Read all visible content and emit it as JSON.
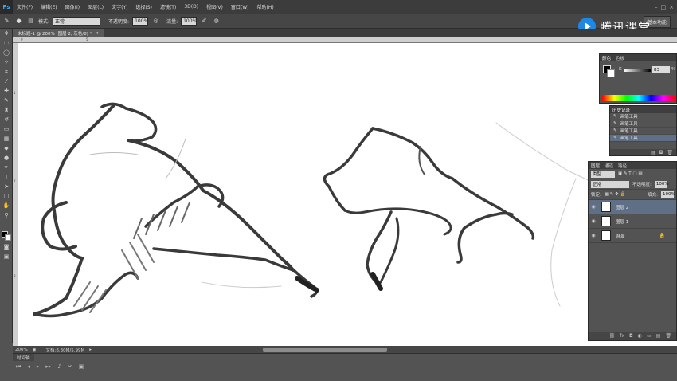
{
  "app": {
    "logo": "Ps"
  },
  "menu": [
    "文件(F)",
    "编辑(E)",
    "图像(I)",
    "图层(L)",
    "文字(Y)",
    "选择(S)",
    "滤镜(T)",
    "3D(D)",
    "视图(V)",
    "窗口(W)",
    "帮助(H)"
  ],
  "options": {
    "mode_label": "模式:",
    "mode_value": "正常",
    "opacity_label": "不透明度:",
    "opacity_value": "100%",
    "flow_label": "流量:",
    "flow_value": "100%",
    "workspace": "基本功能"
  },
  "document": {
    "tab_title": "未标题-1 @ 200% (图层 2, 灰色/8) *"
  },
  "status": {
    "zoom": "200%",
    "doc_info": "文档:8.30M/5.99M"
  },
  "timeline": {
    "tab": "时间轴"
  },
  "color_panel": {
    "tabs": [
      "颜色",
      "色板"
    ],
    "channel_label": "K",
    "channel_value": "83",
    "unit": "%",
    "k_level": 0.83
  },
  "history_panel": {
    "tab": "历史记录",
    "items": [
      "画笔工具",
      "画笔工具",
      "画笔工具",
      "画笔工具"
    ]
  },
  "layers_panel": {
    "tabs": [
      "图层",
      "通道",
      "路径"
    ],
    "kind_label": "类型",
    "blend_mode": "正常",
    "opacity_label": "不透明度:",
    "opacity_value": "100%",
    "lock_label": "锁定:",
    "fill_label": "填充:",
    "fill_value": "100%",
    "layers": [
      {
        "name": "图层 2",
        "selected": true
      },
      {
        "name": "图层 1",
        "selected": false
      },
      {
        "name": "背景",
        "selected": false
      }
    ]
  },
  "watermark": {
    "text": "腾讯课堂",
    "color": "#1e88e5"
  },
  "ruler": {
    "h_ticks": [
      "0",
      "5"
    ],
    "v_ticks": [
      "1",
      "2",
      "3"
    ]
  }
}
